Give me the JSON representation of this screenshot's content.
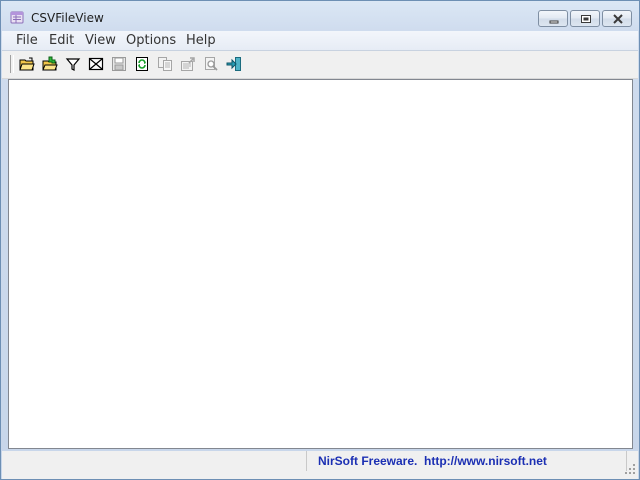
{
  "window": {
    "title": "CSVFileView"
  },
  "menu": {
    "items": [
      "File",
      "Edit",
      "View",
      "Options",
      "Help"
    ]
  },
  "toolbar": {
    "buttons": [
      {
        "icon": "open-folder-icon",
        "enabled": true
      },
      {
        "icon": "open-advanced-icon",
        "enabled": true
      },
      {
        "icon": "filter-icon",
        "enabled": true
      },
      {
        "icon": "clear-filter-icon",
        "enabled": true
      },
      {
        "icon": "save-icon",
        "enabled": false
      },
      {
        "icon": "refresh-icon",
        "enabled": true
      },
      {
        "icon": "copy-icon",
        "enabled": false
      },
      {
        "icon": "properties-icon",
        "enabled": false
      },
      {
        "icon": "find-icon",
        "enabled": false
      },
      {
        "icon": "exit-icon",
        "enabled": true
      }
    ]
  },
  "statusbar": {
    "panel1": "",
    "link_text": "NirSoft Freeware.  http://www.nirsoft.net"
  },
  "colors": {
    "link": "#1b2fb3",
    "frame": "#c7d6ea"
  }
}
